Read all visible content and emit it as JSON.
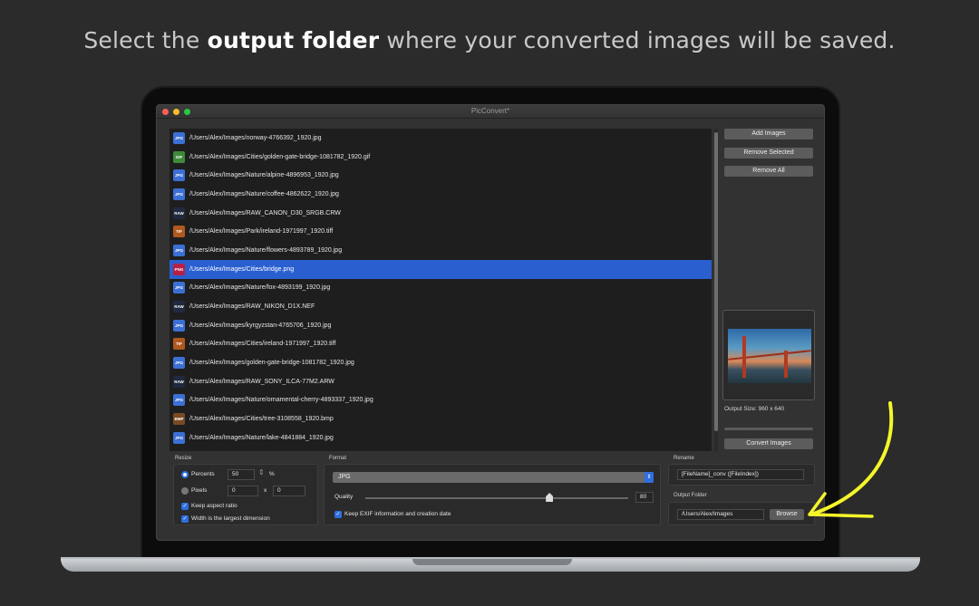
{
  "caption": {
    "pre": "Select the ",
    "bold": "output folder",
    "post": " where your converted images will be saved."
  },
  "window": {
    "title": "PicConvert*"
  },
  "files": [
    {
      "type": "JPG",
      "path": "/Users/Alex/Images/norway-4766392_1920.jpg",
      "selected": false
    },
    {
      "type": "GIF",
      "path": "/Users/Alex/Images/Cities/golden-gate-bridge-1081782_1920.gif",
      "selected": false
    },
    {
      "type": "JPG",
      "path": "/Users/Alex/Images/Nature/alpine-4896953_1920.jpg",
      "selected": false
    },
    {
      "type": "JPG",
      "path": "/Users/Alex/Images/Nature/coffee-4862622_1920.jpg",
      "selected": false
    },
    {
      "type": "RAW",
      "path": "/Users/Alex/Images/RAW_CANON_D30_SRGB.CRW",
      "selected": false
    },
    {
      "type": "TIF",
      "path": "/Users/Alex/Images/Park/ireland-1971997_1920.tiff",
      "selected": false
    },
    {
      "type": "JPG",
      "path": "/Users/Alex/Images/Nature/flowers-4893789_1920.jpg",
      "selected": false
    },
    {
      "type": "PNG",
      "path": "/Users/Alex/Images/Cities/bridge.png",
      "selected": true
    },
    {
      "type": "JPG",
      "path": "/Users/Alex/Images/Nature/fox-4893199_1920.jpg",
      "selected": false
    },
    {
      "type": "RAW",
      "path": "/Users/Alex/Images/RAW_NIKON_D1X.NEF",
      "selected": false
    },
    {
      "type": "JPG",
      "path": "/Users/Alex/Images/kyrgyzstan-4765706_1920.jpg",
      "selected": false
    },
    {
      "type": "TIF",
      "path": "/Users/Alex/Images/Cities/ireland-1971997_1920.tiff",
      "selected": false
    },
    {
      "type": "JPG",
      "path": "/Users/Alex/Images/golden-gate-bridge-1081782_1920.jpg",
      "selected": false
    },
    {
      "type": "RAW",
      "path": "/Users/Alex/Images/RAW_SONY_ILCA-77M2.ARW",
      "selected": false
    },
    {
      "type": "JPG",
      "path": "/Users/Alex/Images/Nature/ornamental-cherry-4893337_1920.jpg",
      "selected": false
    },
    {
      "type": "BMP",
      "path": "/Users/Alex/Images/Cities/tree-3108558_1920.bmp",
      "selected": false
    },
    {
      "type": "JPG",
      "path": "/Users/Alex/Images/Nature/lake-4841884_1920.jpg",
      "selected": false
    }
  ],
  "sidebar": {
    "add_images": "Add Images",
    "remove_selected": "Remove Selected",
    "remove_all": "Remove All",
    "output_size": "Output Size: 960 x 640",
    "convert_images": "Convert Images"
  },
  "resize": {
    "label": "Resize",
    "percents_label": "Percents",
    "percents_value": "50",
    "percent_sign": "%",
    "pixels_label": "Pixels",
    "pixels_w": "0",
    "x_sep": "x",
    "pixels_h": "0",
    "keep_aspect": "Keep aspect ratio",
    "width_largest": "Width is the largest dimension"
  },
  "format": {
    "label": "Format",
    "selected": "JPG",
    "quality_label": "Quality",
    "quality_value": "80",
    "quality_fraction": 0.8,
    "keep_exif": "Keep EXIF information and creation date"
  },
  "rename": {
    "label": "Rename",
    "pattern": "[FileName]_conv ([FileIndex])"
  },
  "output_folder": {
    "label": "Output Folder",
    "path": "/Users/Alex/Images",
    "browse": "Browse"
  },
  "colors": {
    "selection": "#2a5fd0",
    "accent": "#2e6fe0",
    "arrow": "#f5f52a"
  }
}
